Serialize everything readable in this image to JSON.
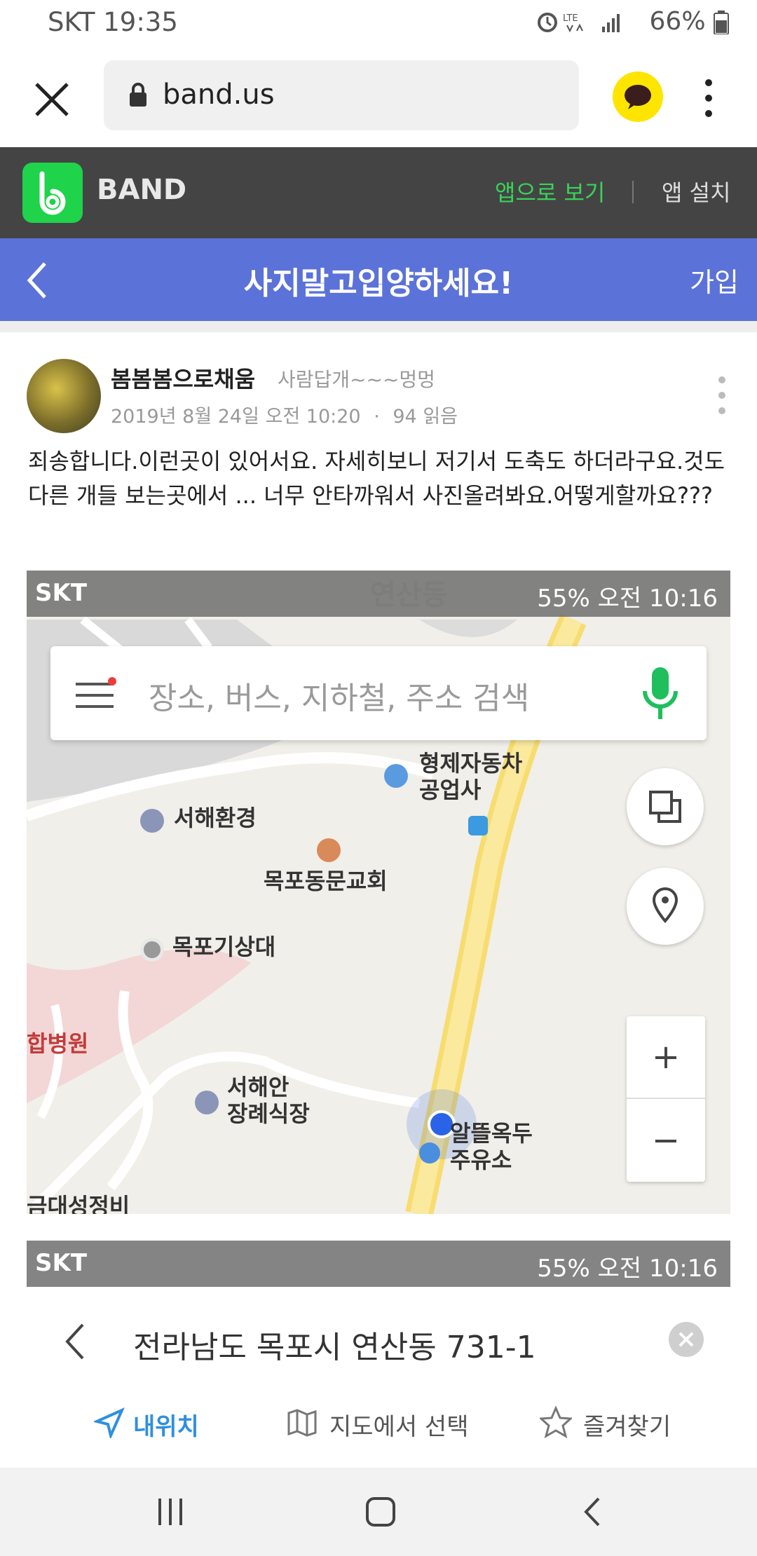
{
  "status_bar": {
    "carrier_time": "SKT 19:35",
    "battery": "66%"
  },
  "browser": {
    "url": "band.us"
  },
  "band_bar": {
    "brand": "BAND",
    "open_in_app": "앱으로 보기",
    "install_app": "앱 설치"
  },
  "group_bar": {
    "title": "사지말고입양하세요!",
    "join": "가입"
  },
  "post": {
    "author": "봄봄봄으로채움",
    "author_sub": "사람답개~~~멍멍",
    "date": "2019년 8월 24일 오전 10:20",
    "reads": "94 읽음",
    "text": "죄송합니다.이런곳이 있어서요. 자세히보니 저기서 도축도 하더라구요.것도 다른 개들 보는곳에서 ... 너무 안타까워서 사진올려봐요.어떻게할까요???"
  },
  "map_screenshot_1": {
    "status_left": "SKT",
    "status_right": "55% 오전 10:16",
    "search_placeholder": "장소, 버스, 지하철, 주소 검색",
    "pois": {
      "p1": "형제자동차\n공업사",
      "p2": "서해환경",
      "p3": "목포동문교회",
      "p4": "목포기상대",
      "p5": "합병원",
      "p6": "서해안\n장례식장",
      "p7": "알뜰옥두\n주유소",
      "p8": "금대성정비",
      "p9": "연산동"
    },
    "zoom_in": "+",
    "zoom_out": "−"
  },
  "map_screenshot_2": {
    "status_left": "SKT",
    "status_right": "55% 오전 10:16",
    "address": "전라남도 목포시 연산동 731-1",
    "my_location": "내위치",
    "pick_on_map": "지도에서 선택",
    "favorites": "즐겨찾기"
  },
  "colors": {
    "band_green": "#1fd34a",
    "group_blue": "#5b72d8",
    "header_dark": "#444444",
    "kakao_yellow": "#fde500"
  },
  "icons": [
    "close-icon",
    "lock-icon",
    "kakao-talk-icon",
    "more-vert-icon",
    "band-logo-icon",
    "back-icon",
    "menu-icon",
    "mic-icon",
    "layers-icon",
    "location-pin-icon",
    "clear-icon",
    "navigation-arrow-icon",
    "map-icon",
    "star-icon",
    "recent-apps-icon",
    "home-icon",
    "back-nav-icon"
  ]
}
